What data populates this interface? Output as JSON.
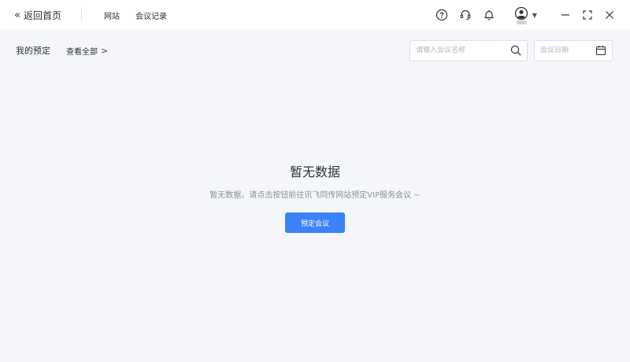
{
  "titlebar": {
    "back_label": "返回首页",
    "nav": [
      "网站",
      "会议记录"
    ],
    "tools": [
      "help-icon",
      "headset-icon",
      "bell-icon"
    ],
    "window_controls": [
      "minimize-icon",
      "maximize-icon",
      "close-icon"
    ]
  },
  "toolbar": {
    "title": "我的预定",
    "see_all": "查看全部",
    "search_placeholder": "请输入会议名称",
    "date_placeholder": "会议日期"
  },
  "empty_state": {
    "title": "暂无数据",
    "description": "暂无数据，请点击按钮前往讯飞同传网站预定VIP服务会议 ~",
    "button": "预定会议"
  },
  "colors": {
    "primary": "#3b82f6",
    "background": "#f5f6fa",
    "titlebar": "#ffffff"
  }
}
